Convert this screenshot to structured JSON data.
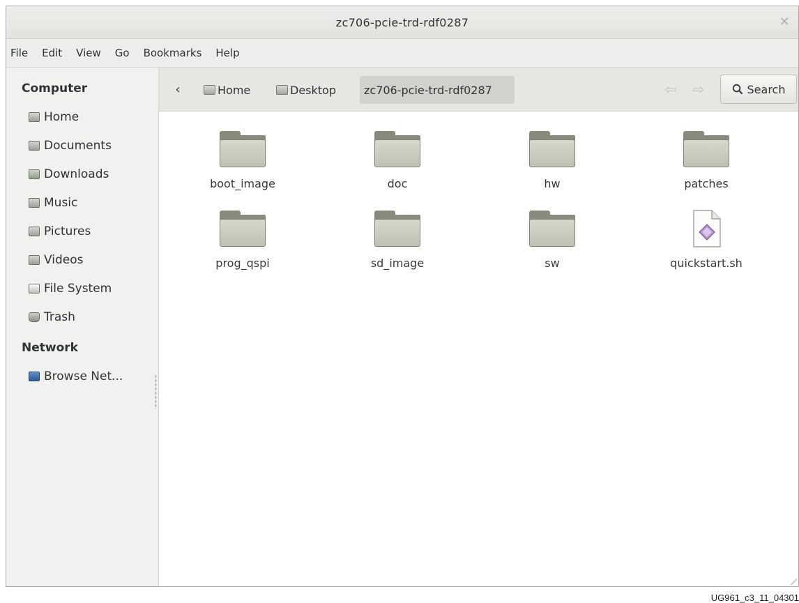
{
  "window": {
    "title": "zc706-pcie-trd-rdf0287",
    "close_glyph": "✕"
  },
  "menubar": {
    "items": [
      "File",
      "Edit",
      "View",
      "Go",
      "Bookmarks",
      "Help"
    ]
  },
  "sidebar": {
    "computer_header": "Computer",
    "places": [
      {
        "label": "Home",
        "icon": "home-folder-icon"
      },
      {
        "label": "Documents",
        "icon": "documents-folder-icon"
      },
      {
        "label": "Downloads",
        "icon": "downloads-folder-icon"
      },
      {
        "label": "Music",
        "icon": "music-folder-icon"
      },
      {
        "label": "Pictures",
        "icon": "pictures-folder-icon"
      },
      {
        "label": "Videos",
        "icon": "videos-folder-icon"
      },
      {
        "label": "File System",
        "icon": "drive-icon"
      },
      {
        "label": "Trash",
        "icon": "trash-icon"
      }
    ],
    "network_header": "Network",
    "network_items": [
      {
        "label": "Browse Net...",
        "icon": "network-icon"
      }
    ]
  },
  "pathbar": {
    "back_glyph": "‹",
    "crumbs": [
      "Home",
      "Desktop",
      "zc706-pcie-trd-rdf0287"
    ],
    "active_crumb": "zc706-pcie-trd-rdf0287",
    "search_label": "Search"
  },
  "files": [
    {
      "name": "boot_image",
      "type": "folder"
    },
    {
      "name": "doc",
      "type": "folder"
    },
    {
      "name": "hw",
      "type": "folder"
    },
    {
      "name": "patches",
      "type": "folder"
    },
    {
      "name": "prog_qspi",
      "type": "folder"
    },
    {
      "name": "sd_image",
      "type": "folder"
    },
    {
      "name": "sw",
      "type": "folder"
    },
    {
      "name": "quickstart.sh",
      "type": "script"
    }
  ],
  "figure_id": "UG961_c3_11_04301"
}
